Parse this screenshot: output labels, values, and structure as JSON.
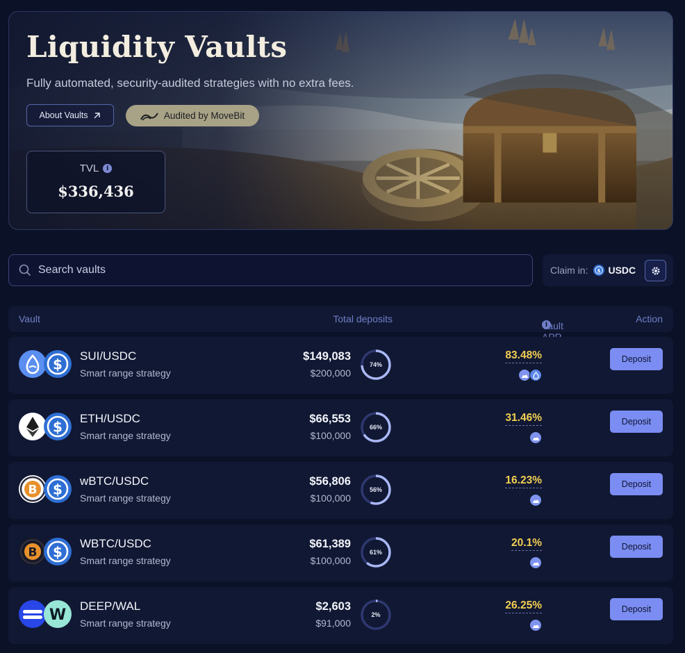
{
  "hero": {
    "title": "Liquidity Vaults",
    "subtitle": "Fully automated, security-audited strategies with no extra fees.",
    "about_label": "About Vaults",
    "audit_label": "Audited by MoveBit",
    "tvl_label": "TVL",
    "tvl_value": "$336,436"
  },
  "search": {
    "placeholder": "Search vaults"
  },
  "claim": {
    "label": "Claim in:",
    "token": "USDC"
  },
  "table": {
    "headers": {
      "vault": "Vault",
      "deposits": "Total deposits",
      "apr": "Vault APR",
      "action": "Action"
    },
    "rows": [
      {
        "name": "SUI/USDC",
        "strategy": "Smart range strategy",
        "deposits": "$149,083",
        "cap": "$200,000",
        "pct_label": "74%",
        "pct": 74,
        "apr": "83.48%",
        "rewards": [
          "cetus-icon",
          "sui-icon"
        ],
        "tokens": [
          "sui-icon",
          "usdc-icon"
        ],
        "action": "Deposit"
      },
      {
        "name": "ETH/USDC",
        "strategy": "Smart range strategy",
        "deposits": "$66,553",
        "cap": "$100,000",
        "pct_label": "66%",
        "pct": 66,
        "apr": "31.46%",
        "rewards": [
          "cetus-icon"
        ],
        "tokens": [
          "eth-icon",
          "usdc-icon"
        ],
        "action": "Deposit"
      },
      {
        "name": "wBTC/USDC",
        "strategy": "Smart range strategy",
        "deposits": "$56,806",
        "cap": "$100,000",
        "pct_label": "56%",
        "pct": 56,
        "apr": "16.23%",
        "rewards": [
          "cetus-icon"
        ],
        "tokens": [
          "wbtc-icon",
          "usdc-icon"
        ],
        "action": "Deposit"
      },
      {
        "name": "WBTC/USDC",
        "strategy": "Smart range strategy",
        "deposits": "$61,389",
        "cap": "$100,000",
        "pct_label": "61%",
        "pct": 61,
        "apr": "20.1%",
        "rewards": [
          "cetus-icon"
        ],
        "tokens": [
          "btc-dark-icon",
          "usdc-icon"
        ],
        "action": "Deposit"
      },
      {
        "name": "DEEP/WAL",
        "strategy": "Smart range strategy",
        "deposits": "$2,603",
        "cap": "$91,000",
        "pct_label": "2%",
        "pct": 2,
        "apr": "26.25%",
        "rewards": [
          "cetus-icon"
        ],
        "tokens": [
          "deep-icon",
          "wal-icon"
        ],
        "action": "Deposit"
      }
    ]
  },
  "colors": {
    "accent": "#7b8df2",
    "apr": "#f2cf52",
    "background": "#0b1127",
    "row": "#111833"
  }
}
